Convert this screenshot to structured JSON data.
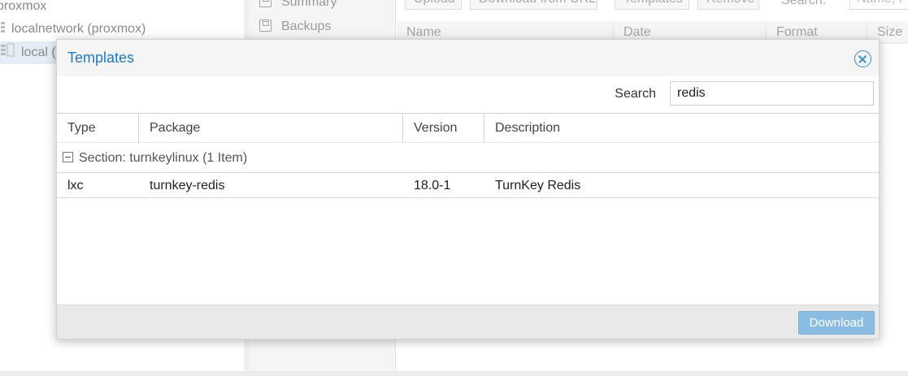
{
  "tree": {
    "items": [
      {
        "label": "proxmox"
      },
      {
        "label": "localnetwork (proxmox)"
      },
      {
        "label": "local (proxmox)"
      }
    ]
  },
  "nav": {
    "items": [
      {
        "label": "Summary",
        "icon": "summary-icon"
      },
      {
        "label": "Backups",
        "icon": "floppy-icon"
      }
    ]
  },
  "storage_toolbar": {
    "upload_label": "Upload",
    "download_url_label": "Download from URL",
    "templates_label": "Templates",
    "remove_label": "Remove",
    "search_label": "Search:",
    "search_placeholder": "Name, Format"
  },
  "storage_grid": {
    "columns": [
      "Name",
      "Date",
      "Format",
      "Size"
    ]
  },
  "dialog": {
    "title": "Templates",
    "search_label": "Search",
    "search_value": "redis",
    "columns": {
      "type": "Type",
      "package": "Package",
      "version": "Version",
      "description": "Description"
    },
    "group_label": "Section: turnkeylinux (1 Item)",
    "rows": [
      {
        "type": "lxc",
        "package": "turnkey-redis",
        "version": "18.0-1",
        "description": "TurnKey Redis"
      }
    ],
    "download_label": "Download"
  },
  "colors": {
    "accent": "#1f7ac0",
    "button_disabled": "#8bbde3",
    "selection": "#e4ecf5"
  }
}
